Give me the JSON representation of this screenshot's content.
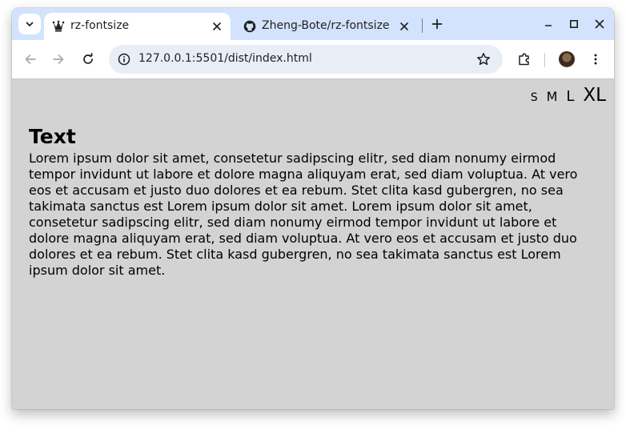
{
  "browser": {
    "tabs": [
      {
        "title": "rz-fontsize",
        "active": true,
        "icon": "jester-favicon"
      },
      {
        "title": "Zheng-Bote/rz-fontsize",
        "active": false,
        "icon": "github-icon"
      }
    ],
    "address_bar": {
      "url": "127.0.0.1:5501/dist/index.html"
    }
  },
  "page": {
    "font_size_options": [
      "S",
      "M",
      "L",
      "XL"
    ],
    "heading": "Text",
    "paragraph": "Lorem ipsum dolor sit amet, consetetur sadipscing elitr, sed diam nonumy eirmod tempor invidunt ut labore et dolore magna aliquyam erat, sed diam voluptua. At vero eos et accusam et justo duo dolores et ea rebum. Stet clita kasd gubergren, no sea takimata sanctus est Lorem ipsum dolor sit amet. Lorem ipsum dolor sit amet, consetetur sadipscing elitr, sed diam nonumy eirmod tempor invidunt ut labore et dolore magna aliquyam erat, sed diam voluptua. At vero eos et accusam et justo duo dolores et ea rebum. Stet clita kasd gubergren, no sea takimata sanctus est Lorem ipsum dolor sit amet."
  },
  "colors": {
    "tab_strip": "#d3e3fd",
    "page_background": "#d3d3d3",
    "omnibox": "#e9eef6"
  }
}
